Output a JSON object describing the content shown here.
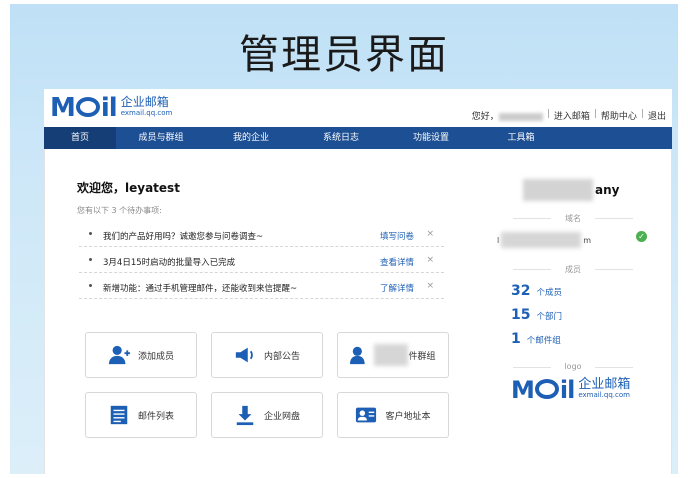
{
  "slide": {
    "title": "管理员界面"
  },
  "header": {
    "logo_mark": "MOil",
    "logo_cn": "企业邮箱",
    "logo_url": "exmail.qq.com",
    "greeting": "您好，",
    "links": [
      "进入邮箱",
      "帮助中心",
      "退出"
    ]
  },
  "nav": {
    "items": [
      "首页",
      "成员与群组",
      "我的企业",
      "系统日志",
      "功能设置",
      "工具箱"
    ],
    "active": 0
  },
  "main": {
    "welcome": "欢迎您，leyatest",
    "todo_hint": "您有以下 3 个待办事项:",
    "todos": [
      {
        "text": "我们的产品好用吗？诚邀您参与问卷调查~",
        "action": "填写问卷"
      },
      {
        "text": "3月4日15时启动的批量导入已完成",
        "action": "查看详情"
      },
      {
        "text": "新增功能：通过手机管理邮件，还能收到来信提醒~",
        "action": "了解详情"
      }
    ],
    "tiles": [
      {
        "label": "添加成员",
        "icon": "add-user-icon"
      },
      {
        "label": "内部公告",
        "icon": "megaphone-icon"
      },
      {
        "label": "件群组",
        "icon": "group-icon"
      },
      {
        "label": "邮件列表",
        "icon": "list-icon"
      },
      {
        "label": "企业网盘",
        "icon": "download-icon"
      },
      {
        "label": "客户地址本",
        "icon": "contact-card-icon"
      }
    ]
  },
  "side": {
    "company_suffix": "any",
    "domain_label": "域名",
    "domain_prefix": "l",
    "domain_suffix": "m",
    "members_label": "成员",
    "stats": [
      {
        "value": "32",
        "unit": "个成员"
      },
      {
        "value": "15",
        "unit": "个部门"
      },
      {
        "value": "1",
        "unit": "个邮件组"
      }
    ],
    "logo_label": "logo"
  },
  "colors": {
    "brand": "#1d5fb4",
    "nav_bg": "#1c4f93",
    "nav_active": "#153e76"
  }
}
